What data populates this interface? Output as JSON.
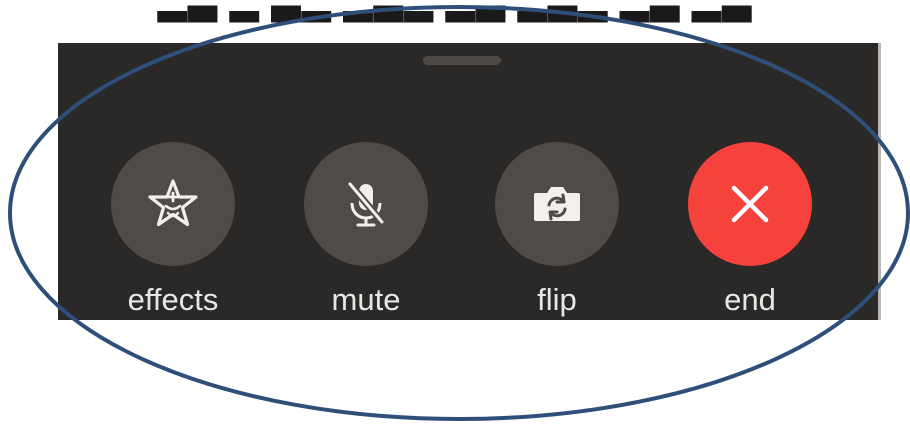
{
  "controls": {
    "effects_label": "effects",
    "mute_label": "mute",
    "flip_label": "flip",
    "end_label": "end"
  },
  "icons": {
    "effects": "star-sparkle-icon",
    "mute": "microphone-slash-icon",
    "flip": "camera-rotate-icon",
    "end": "close-x-icon"
  },
  "colors": {
    "panel_background": "#2b2927",
    "button_background": "#4f4b48",
    "end_button": "#f5423c",
    "annotation_ellipse": "#2e4f7a"
  }
}
